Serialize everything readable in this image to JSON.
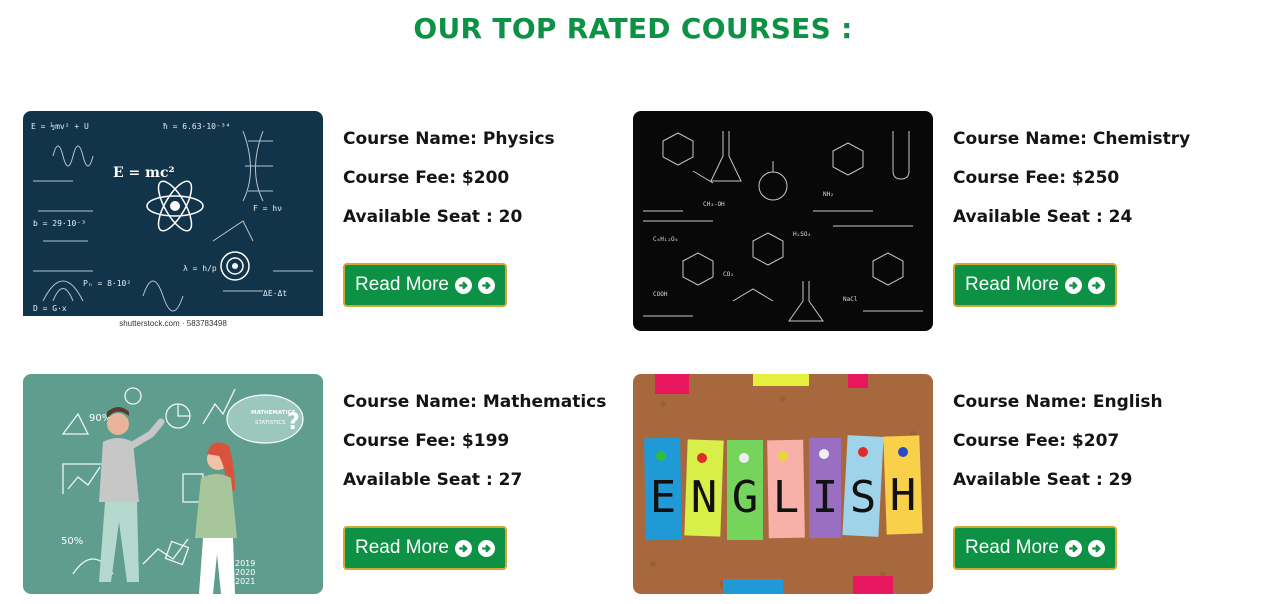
{
  "page": {
    "heading": "OUR TOP RATED COURSES :",
    "accent_color": "#0d9145",
    "button_border_color": "#d6a531"
  },
  "courses": [
    {
      "name_line": "Course Name: Physics",
      "fee_line": "Course Fee: $200",
      "seat_line": "Available Seat : 20",
      "button_label": "Read More",
      "image_caption": "shutterstock.com · 583783498",
      "image_formula": "E = mc²"
    },
    {
      "name_line": "Course Name: Chemistry",
      "fee_line": "Course Fee: $250",
      "seat_line": "Available Seat : 24",
      "button_label": "Read More"
    },
    {
      "name_line": "Course Name: Mathematics",
      "fee_line": "Course Fee: $199",
      "seat_line": "Available Seat : 27",
      "button_label": "Read More",
      "image_bubble": "MATHEMATICS STATISTICS",
      "image_percent_a": "90%",
      "image_percent_b": "50%",
      "image_years": "2019 2020 2021"
    },
    {
      "name_line": "Course Name: English",
      "fee_line": "Course Fee: $207",
      "seat_line": "Available Seat : 29",
      "button_label": "Read More",
      "image_word": "ENGLISH"
    }
  ]
}
